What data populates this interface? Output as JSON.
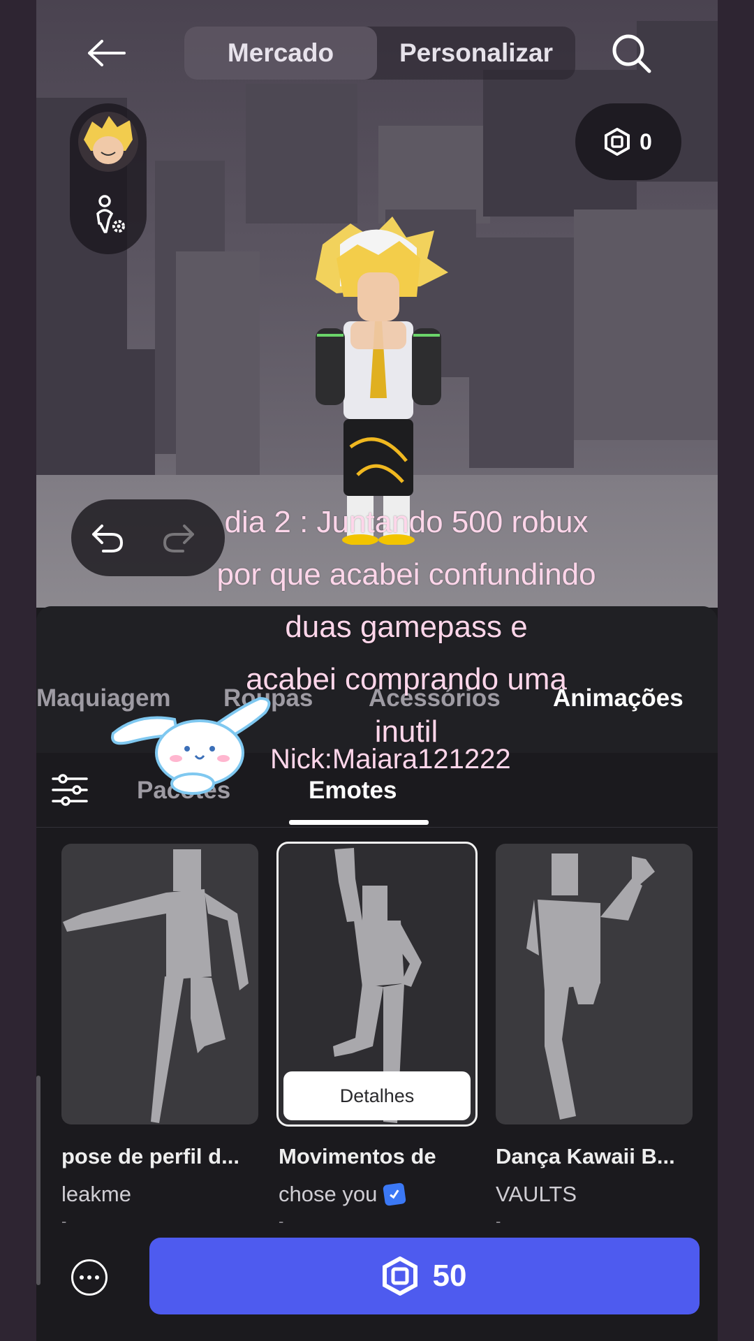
{
  "header": {
    "tabs": [
      {
        "label": "Mercado",
        "active": true
      },
      {
        "label": "Personalizar",
        "active": false
      }
    ]
  },
  "robux_balance": "0",
  "categories": [
    {
      "label": "Maquiagem",
      "active": false
    },
    {
      "label": "Roupas",
      "active": false
    },
    {
      "label": "Acessórios",
      "active": false
    },
    {
      "label": "Animações",
      "active": true
    }
  ],
  "subtabs": [
    {
      "label": "Pacotes",
      "active": false
    },
    {
      "label": "Emotes",
      "active": true
    }
  ],
  "items": [
    {
      "title": "pose de perfil d...",
      "creator": "leakme",
      "verified": false,
      "price": "-"
    },
    {
      "title": "Movimentos de",
      "creator": "chose you",
      "verified": true,
      "price": "-",
      "selected": true,
      "details_label": "Detalhes"
    },
    {
      "title": "Dança Kawaii B...",
      "creator": "VAULTS",
      "verified": false,
      "price": "-"
    }
  ],
  "buy_button": {
    "price": "50"
  },
  "overlay": {
    "caption_lines": [
      "dia 2 : Juntando 500 robux",
      "por que acabei confundindo",
      "duas gamepass e",
      "acabei comprando uma",
      "inutil"
    ],
    "nick": "Nick:Maiara121222"
  },
  "colors": {
    "accent": "#4e5bef",
    "caption": "#ffd6ea",
    "panel": "#1b1a1e"
  }
}
